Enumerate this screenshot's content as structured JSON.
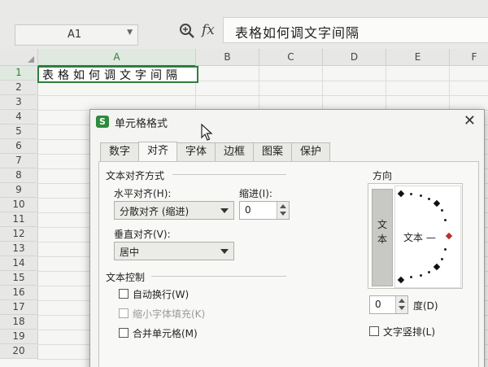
{
  "formula_bar": {
    "name_box_value": "A1",
    "fx_label": "fx",
    "formula_text": "表格如何调文字间隔"
  },
  "sheet": {
    "columns": [
      "A",
      "B",
      "C",
      "D",
      "E",
      "F"
    ],
    "rows": [
      "1",
      "2",
      "3",
      "4",
      "5",
      "6",
      "7",
      "8",
      "9",
      "10",
      "11",
      "12",
      "13",
      "14",
      "15",
      "16",
      "17",
      "18",
      "19",
      "20"
    ],
    "a1_text": "表格如何调文字间隔",
    "active_cell": "A1"
  },
  "dialog": {
    "icon_letter": "S",
    "title": "单元格格式",
    "close_label": "✕",
    "tabs": [
      "数字",
      "对齐",
      "字体",
      "边框",
      "图案",
      "保护"
    ],
    "active_tab": "对齐",
    "alignment_section": "文本对齐方式",
    "horizontal_label": "水平对齐(H):",
    "horizontal_value": "分散对齐 (缩进)",
    "indent_label": "缩进(I):",
    "indent_value": "0",
    "vertical_label": "垂直对齐(V):",
    "vertical_value": "居中",
    "text_control_section": "文本控制",
    "wrap_text": "自动换行(W)",
    "shrink_to_fit": "缩小字体填充(K)",
    "merge_cells": "合并单元格(M)",
    "direction_label": "方向",
    "vertical_text_button": "文本",
    "dial_text": "文本 —",
    "degree_value": "0",
    "degree_label": "度(D)",
    "vertical_stack": "文字竖排(L)"
  },
  "colors": {
    "accent_green": "#2f7d3e",
    "dial_marker_red": "#b8322c"
  }
}
